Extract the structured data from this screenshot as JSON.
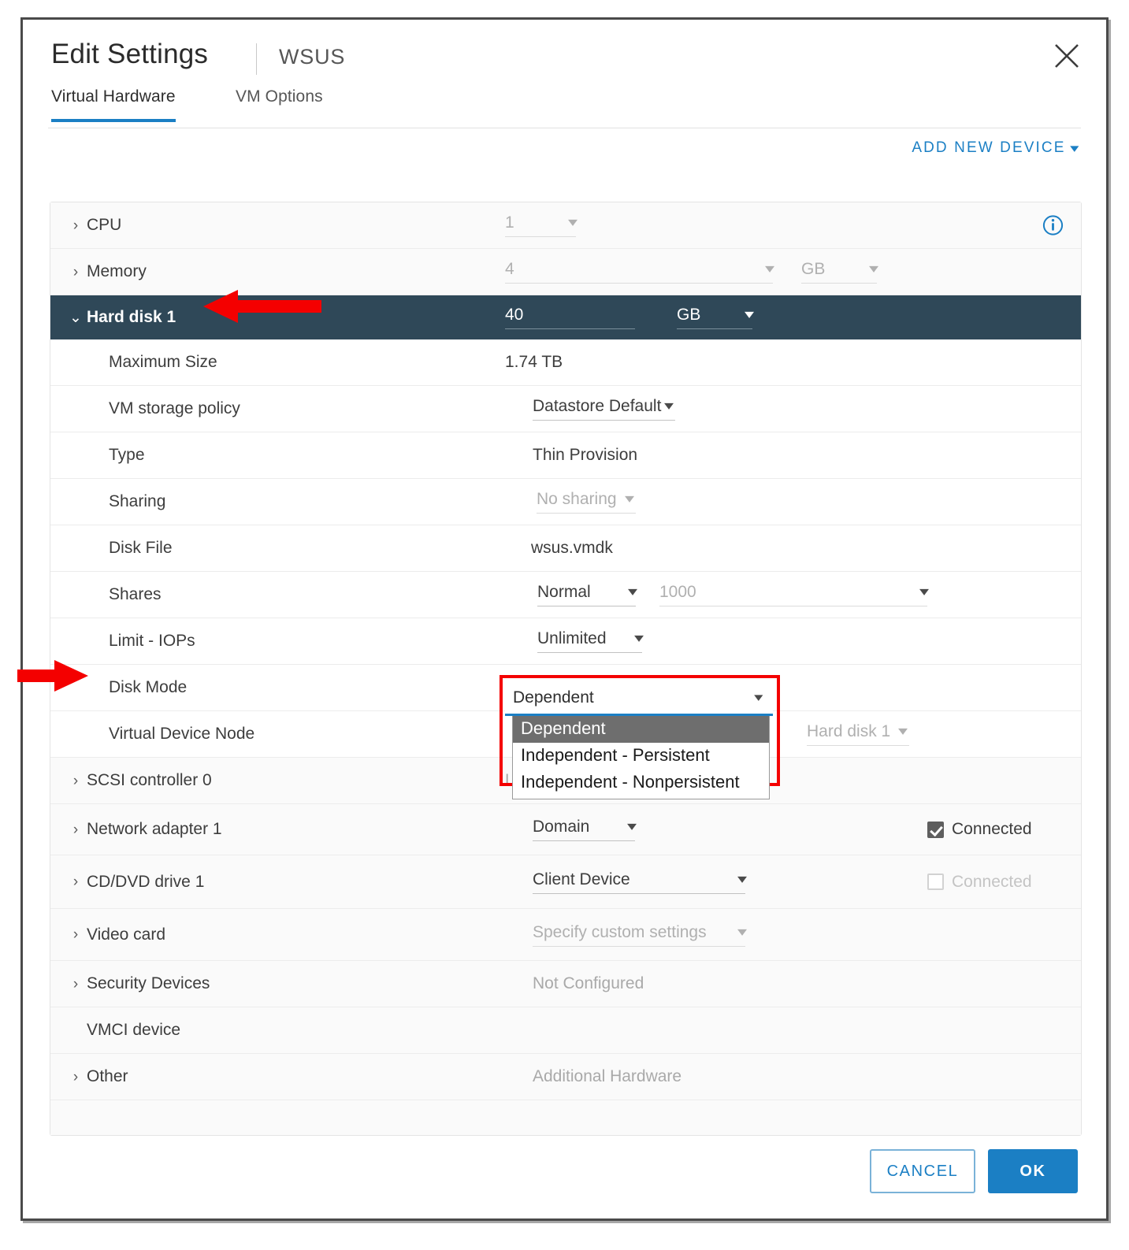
{
  "dialog": {
    "title": "Edit Settings",
    "subtitle": "WSUS",
    "close_icon": "close-icon"
  },
  "tabs": [
    {
      "label": "Virtual Hardware",
      "active": true
    },
    {
      "label": "VM Options",
      "active": false
    }
  ],
  "toolbar": {
    "add_new_device": "ADD NEW DEVICE",
    "add_new_device_caret": "∨"
  },
  "rows": {
    "cpu": {
      "label": "CPU",
      "value": "1",
      "info_icon": "info-circle-icon"
    },
    "memory": {
      "label": "Memory",
      "value": "4",
      "unit": "GB"
    },
    "hard_disk": {
      "label": "Hard disk 1",
      "value": "40",
      "unit": "GB"
    },
    "maximum_size": {
      "label": "Maximum Size",
      "value": "1.74 TB"
    },
    "vm_storage_policy": {
      "label": "VM storage policy",
      "value": "Datastore Default"
    },
    "type": {
      "label": "Type",
      "value": "Thin Provision"
    },
    "sharing": {
      "label": "Sharing",
      "value": "No sharing"
    },
    "disk_file": {
      "label": "Disk File",
      "value": "wsus.vmdk"
    },
    "shares": {
      "label": "Shares",
      "value": "Normal",
      "amount": "1000"
    },
    "limit_iops": {
      "label": "Limit - IOPs",
      "value": "Unlimited"
    },
    "disk_mode": {
      "label": "Disk Mode",
      "value": "Dependent"
    },
    "virtual_device_node": {
      "label": "Virtual Device Node",
      "value": "Hard disk 1"
    },
    "scsi_controller": {
      "label": "SCSI controller 0",
      "value": "LSI Logic SAS"
    },
    "network_adapter": {
      "label": "Network adapter 1",
      "value": "Domain",
      "connected_label": "Connected",
      "connected": true
    },
    "cd_dvd_drive": {
      "label": "CD/DVD drive 1",
      "value": "Client Device",
      "connected_label": "Connected",
      "connected": false
    },
    "video_card": {
      "label": "Video card",
      "value": "Specify custom settings"
    },
    "security_devices": {
      "label": "Security Devices",
      "value": "Not Configured"
    },
    "vmci_device": {
      "label": "VMCI device",
      "value": ""
    },
    "other": {
      "label": "Other",
      "value": "Additional Hardware"
    }
  },
  "disk_mode_dropdown": {
    "selected": "Dependent",
    "options": [
      "Dependent",
      "Independent - Persistent",
      "Independent - Nonpersistent"
    ]
  },
  "footer": {
    "cancel": "CANCEL",
    "ok": "OK"
  },
  "annotations": {
    "arrow_color": "#f40000",
    "highlight_color": "#f40000",
    "arrow_hard_disk_direction": "left",
    "arrow_disk_mode_direction": "right"
  },
  "colors": {
    "accent": "#1b7fc4",
    "selected_row": "#2f4858",
    "panel": "#fafafa"
  }
}
